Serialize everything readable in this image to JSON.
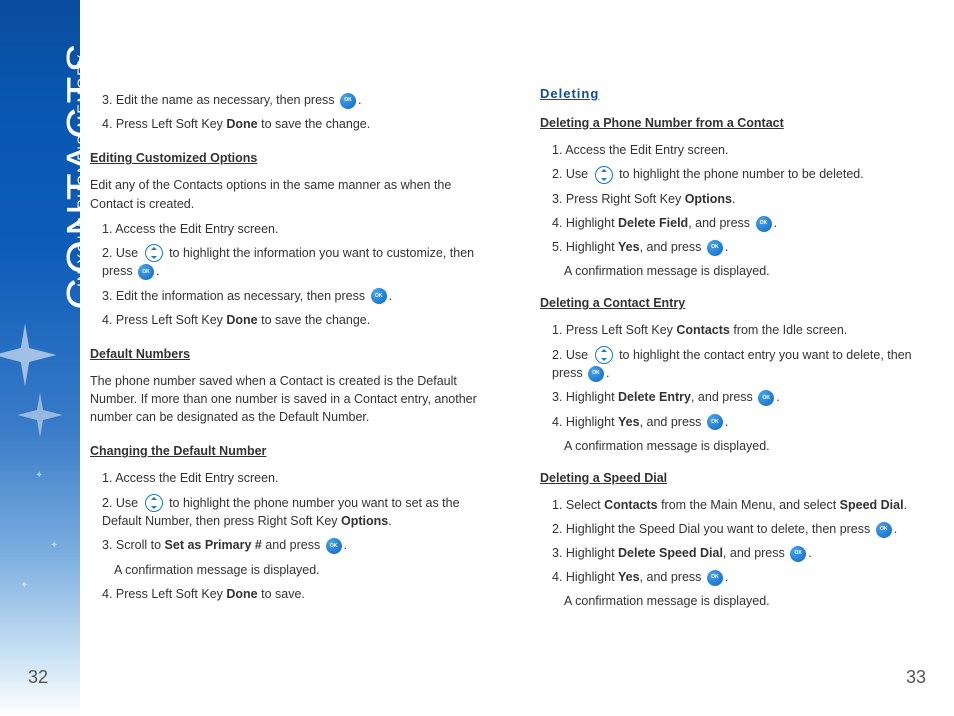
{
  "sidebar": {
    "title": "CONTACTS",
    "subtitle": "IN YOUR PHONE'S MEMORY"
  },
  "left": {
    "step3": {
      "pre": "3. Edit the name as necessary, then press ",
      "post": "."
    },
    "step4": {
      "pre": "4. Press Left Soft Key ",
      "done": "Done",
      "post": " to save the change."
    },
    "editCustom": {
      "heading": "Editing Customized Options",
      "intro": "Edit any of the Contacts options in the same manner as when the Contact is created.",
      "s1": "1. Access the Edit Entry screen.",
      "s2": {
        "pre": "2. Use ",
        "mid": " to highlight the information you want to customize, then press ",
        "post": "."
      },
      "s3": {
        "pre": "3. Edit the information as necessary, then press ",
        "post": "."
      },
      "s4": {
        "pre": "4. Press Left Soft Key ",
        "done": "Done",
        "post": " to save the change."
      }
    },
    "defaultNumbers": {
      "heading": "Default Numbers",
      "body": "The phone number saved when a Contact is created is the Default Number. If more than one number is saved in a Contact entry, another number can be designated as the Default Number."
    },
    "changing": {
      "heading": "Changing the Default Number",
      "s1": "1. Access the Edit Entry screen.",
      "s2": {
        "pre": "2. Use ",
        "mid": " to highlight the phone number you want to set as the Default Number, then press Right Soft Key ",
        "options": "Options",
        "post": "."
      },
      "s3": {
        "pre": "3. Scroll to ",
        "bold": "Set as Primary #",
        "mid": " and press ",
        "post": "."
      },
      "s3b": "A confirmation message is displayed.",
      "s4": {
        "pre": "4. Press Left Soft Key ",
        "done": "Done",
        "post": " to save."
      }
    }
  },
  "right": {
    "deleting": "Deleting",
    "delPhone": {
      "heading": "Deleting a Phone Number from a Contact",
      "s1": "1. Access the Edit Entry screen.",
      "s2": {
        "pre": "2. Use ",
        "post": " to highlight the phone number to be deleted."
      },
      "s3": {
        "pre": "3. Press Right Soft Key ",
        "options": "Options",
        "post": "."
      },
      "s4": {
        "pre": "4. Highlight ",
        "bold": "Delete Field",
        "mid": ", and press ",
        "post": "."
      },
      "s5": {
        "pre": "5. Highlight ",
        "yes": "Yes",
        "mid": ", and press ",
        "post": "."
      },
      "conf": "A confirmation message is displayed."
    },
    "delContact": {
      "heading": "Deleting a Contact Entry",
      "s1": {
        "pre": "1. Press Left Soft Key ",
        "bold": "Contacts",
        "post": " from the Idle screen."
      },
      "s2": {
        "pre": "2. Use ",
        "mid": " to highlight the contact entry you want to delete, then press ",
        "post": "."
      },
      "s3": {
        "pre": "3. Highlight ",
        "bold": "Delete Entry",
        "mid": ", and press ",
        "post": "."
      },
      "s4": {
        "pre": "4. Highlight ",
        "yes": "Yes",
        "mid": ", and press ",
        "post": "."
      },
      "conf": "A confirmation message is displayed."
    },
    "delSpeed": {
      "heading": "Deleting a Speed Dial",
      "s1": {
        "pre": "1. Select ",
        "b1": "Contacts",
        "mid": " from the Main Menu, and select ",
        "b2": "Speed Dial",
        "post": "."
      },
      "s2": {
        "pre": "2. Highlight the Speed Dial you want to delete, then press ",
        "post": "."
      },
      "s3": {
        "pre": "3. Highlight ",
        "bold": "Delete Speed Dial",
        "mid": ", and press ",
        "post": "."
      },
      "s4": {
        "pre": "4. Highlight ",
        "yes": "Yes",
        "mid": ", and press ",
        "post": "."
      },
      "conf": "A confirmation message is displayed."
    }
  },
  "pages": {
    "left": "32",
    "right": "33"
  }
}
